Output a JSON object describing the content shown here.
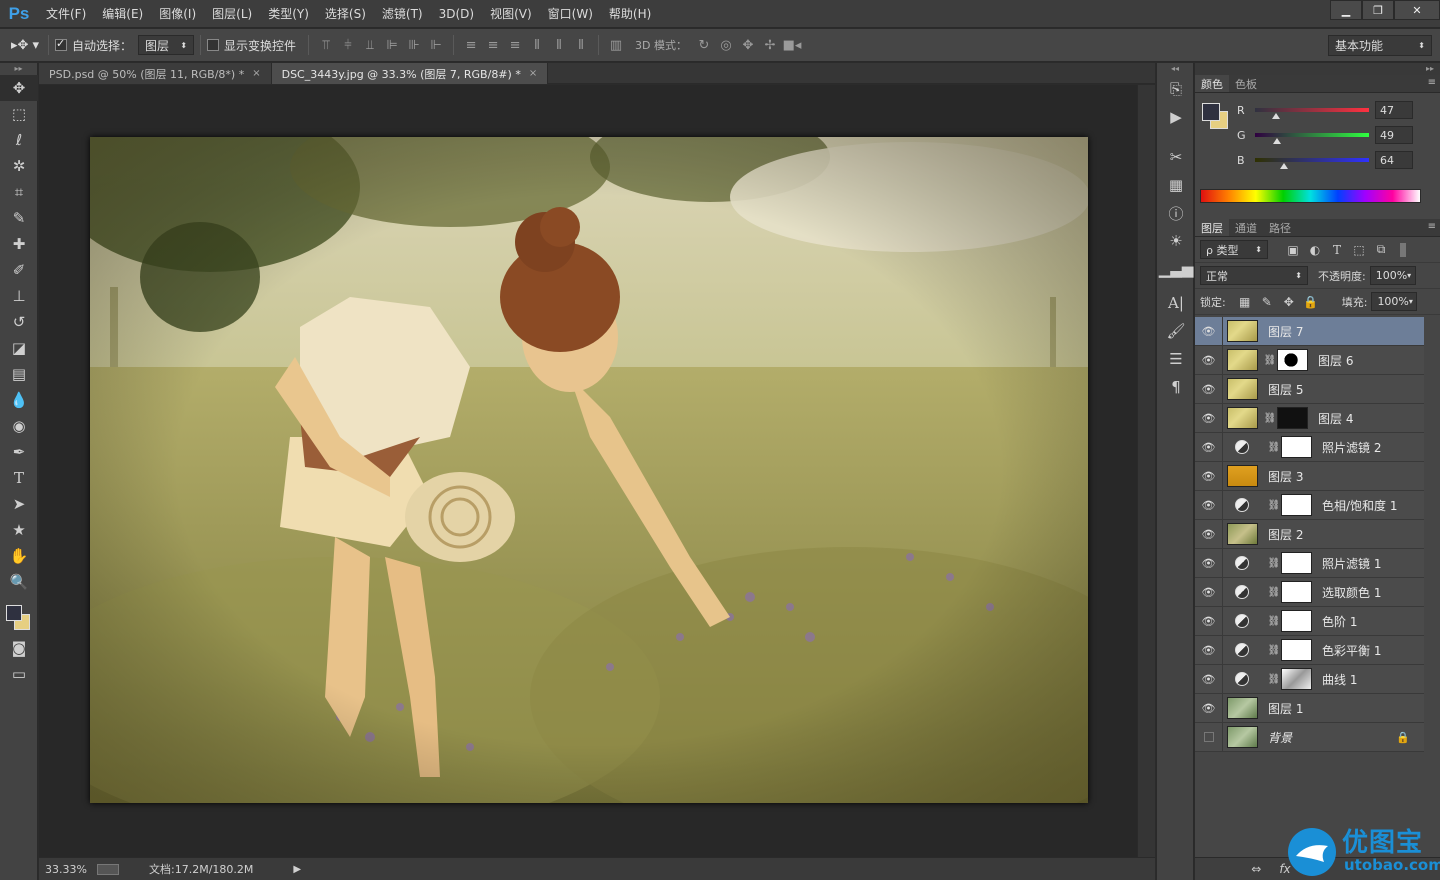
{
  "app": {
    "logo": "Ps",
    "menus": [
      "文件(F)",
      "编辑(E)",
      "图像(I)",
      "图层(L)",
      "类型(Y)",
      "选择(S)",
      "滤镜(T)",
      "3D(D)",
      "视图(V)",
      "窗口(W)",
      "帮助(H)"
    ]
  },
  "options": {
    "auto_select_label": "自动选择：",
    "auto_select_value": "图层",
    "show_transform_label": "显示变换控件",
    "mode_3d_label": "3D 模式：",
    "workspace": "基本功能"
  },
  "tabs": [
    {
      "label": "PSD.psd @ 50% (图层 11, RGB/8*) *",
      "close": "×"
    },
    {
      "label": "DSC_3443y.jpg @ 33.3% (图层 7, RGB/8#) *",
      "close": "×"
    }
  ],
  "status": {
    "zoom": "33.33%",
    "doc_info": "文档:17.2M/180.2M"
  },
  "color_panel": {
    "tabs": [
      "颜色",
      "色板"
    ],
    "channels": [
      {
        "label": "R",
        "value": "47",
        "level": 0.184,
        "gradient": "linear-gradient(to right,#2f3140,#ff3140)"
      },
      {
        "label": "G",
        "value": "49",
        "level": 0.192,
        "gradient": "linear-gradient(to right,#2f0040,#2fff40)"
      },
      {
        "label": "B",
        "value": "64",
        "level": 0.251,
        "gradient": "linear-gradient(to right,#2f3100,#2f31ff)"
      }
    ],
    "foreground": "#2f3140",
    "background": "#e6cf82"
  },
  "layers_panel": {
    "tabs": [
      "图层",
      "通道",
      "路径"
    ],
    "filter_label": "ρ 类型",
    "blend_mode": "正常",
    "opacity_label": "不透明度:",
    "opacity_value": "100%",
    "lock_label": "锁定:",
    "fill_label": "填充:",
    "fill_value": "100%",
    "layers": [
      {
        "name": "图层 7",
        "thumb": "flowers",
        "selected": true
      },
      {
        "name": "图层 6",
        "thumb": "flowers",
        "mask": "silhouette"
      },
      {
        "name": "图层 5",
        "thumb": "flowers"
      },
      {
        "name": "图层 4",
        "thumb": "flowers",
        "mask": "dark"
      },
      {
        "name": "照片滤镜 2",
        "adjustment": true,
        "mask": "white"
      },
      {
        "name": "图层 3",
        "thumb": "orange"
      },
      {
        "name": "色相/饱和度 1",
        "adjustment": true,
        "mask": "white"
      },
      {
        "name": "图层 2",
        "thumb": "field"
      },
      {
        "name": "照片滤镜 1",
        "adjustment": true,
        "mask": "white"
      },
      {
        "name": "选取颜色 1",
        "adjustment": true,
        "mask": "white"
      },
      {
        "name": "色阶 1",
        "adjustment": true,
        "mask": "white"
      },
      {
        "name": "色彩平衡 1",
        "adjustment": true,
        "mask": "white"
      },
      {
        "name": "曲线 1",
        "adjustment": true,
        "mask": "bw"
      },
      {
        "name": "图层 1",
        "thumb": "green"
      },
      {
        "name": "背景",
        "thumb": "green",
        "italic": true,
        "locked": true,
        "hidden_eye": true
      }
    ],
    "bottom_icons": [
      "⇔",
      "fx",
      "◫"
    ]
  },
  "watermark": {
    "text_cn": "优图宝",
    "text_url": "utobao.com"
  },
  "colors": {
    "accent": "#3fa0e8",
    "selected_layer": "#6d7e98"
  }
}
